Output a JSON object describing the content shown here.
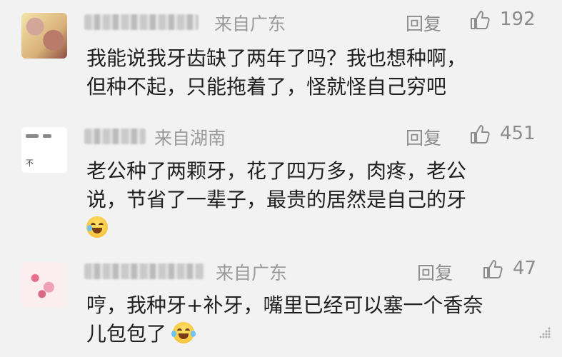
{
  "comments": [
    {
      "location": "来自广东",
      "reply_label": "回复",
      "likes": "192",
      "lines": [
        "我能说我牙齿缺了两年了吗？我也想种啊，",
        "但种不起，只能拖着了，怪就怪自己穷吧"
      ],
      "emoji": ""
    },
    {
      "location": "来自湖南",
      "reply_label": "回复",
      "likes": "451",
      "avatar_text": "不",
      "lines": [
        "老公种了两颗牙，花了四万多，肉疼，老公",
        "说，节省了一辈子，最贵的居然是自己的牙"
      ],
      "emoji": "crying-laughing-emoji"
    },
    {
      "location": "来自广东",
      "reply_label": "回复",
      "likes": "47",
      "lines": [
        "哼，我种牙+补牙，嘴里已经可以塞一个香奈",
        "儿包包了"
      ],
      "emoji": "laughing-tears-emoji"
    }
  ],
  "colors": {
    "background": "#f2f2f2",
    "text": "#1f1f1f",
    "meta": "#9a9a9a"
  }
}
